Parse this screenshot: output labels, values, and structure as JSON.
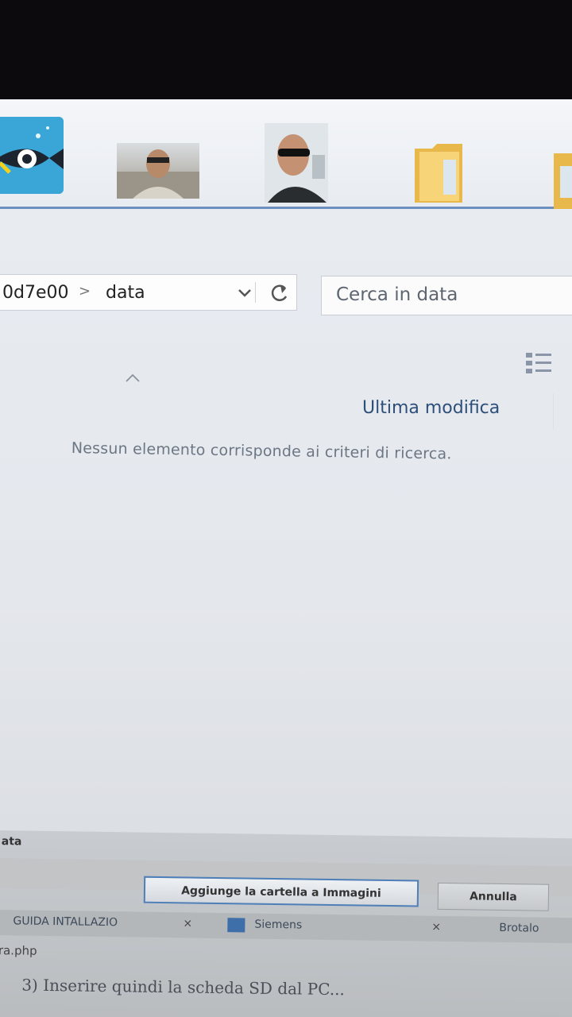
{
  "thumbnails": [
    "fish-app-icon",
    "photo-person-1",
    "photo-person-2",
    "folder-icon",
    "folder-icon"
  ],
  "address_bar": {
    "path_prev": "0d7e00",
    "separator": ">",
    "current": "data"
  },
  "search": {
    "placeholder": "Cerca in data"
  },
  "columns": {
    "modified": "Ultima modifica"
  },
  "content": {
    "empty_message": "Nessun elemento corrisponde ai criteri di ricerca."
  },
  "dialog": {
    "title": "ata",
    "add_button": "Aggiunge la cartella a Immagini",
    "cancel_button": "Annulla"
  },
  "underlying_tabs": [
    {
      "label": "GUIDA INTALLAZIO",
      "close": "×"
    },
    {
      "label": "Siemens",
      "close": "×"
    },
    {
      "label": "Brotalo"
    }
  ],
  "underlying_doc": {
    "line1": "ra.php",
    "line2": "3) Inserire quindi la scheda SD dal PC..."
  },
  "colors": {
    "accent": "#2d4f7a",
    "border": "#c9ced6",
    "fish_icon": "#3aa6d8",
    "button_border": "#4f7fb8"
  }
}
